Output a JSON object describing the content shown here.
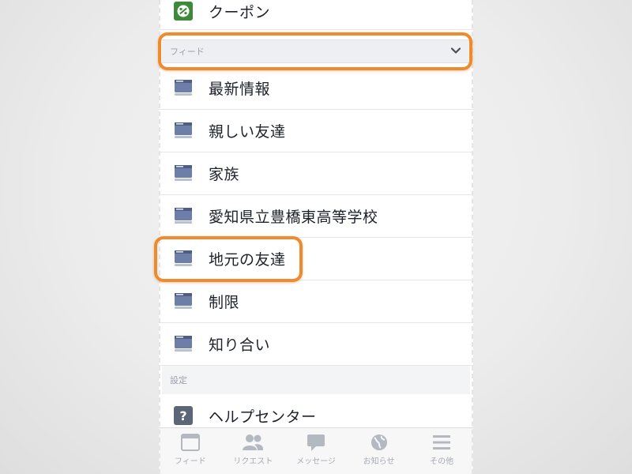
{
  "top_item": {
    "label": "クーポン",
    "icon": "coupon-icon"
  },
  "feed_section": {
    "label": "フィード",
    "icon": "chevron-down-icon"
  },
  "feeds": [
    {
      "label": "最新情報",
      "icon": "feed-list-icon"
    },
    {
      "label": "親しい友達",
      "icon": "feed-list-icon"
    },
    {
      "label": "家族",
      "icon": "feed-list-icon"
    },
    {
      "label": "愛知県立豊橋東高等学校",
      "icon": "feed-list-icon"
    },
    {
      "label": "地元の友達",
      "icon": "feed-list-icon"
    },
    {
      "label": "制限",
      "icon": "feed-list-icon"
    },
    {
      "label": "知り合い",
      "icon": "feed-list-icon"
    }
  ],
  "settings_section": {
    "label": "設定"
  },
  "help_item": {
    "label": "ヘルプセンター",
    "icon": "help-icon"
  },
  "tabbar": [
    {
      "label": "フィード",
      "icon": "feed-icon"
    },
    {
      "label": "リクエスト",
      "icon": "friend-requests-icon"
    },
    {
      "label": "メッセージ",
      "icon": "messages-icon"
    },
    {
      "label": "お知らせ",
      "icon": "notifications-globe-icon"
    },
    {
      "label": "その他",
      "icon": "more-menu-icon"
    }
  ],
  "colors": {
    "highlight": "#ef8a2d",
    "icon_blue": "#5b6f9e",
    "coupon_green": "#3e8a3b",
    "text": "#1d2129"
  }
}
